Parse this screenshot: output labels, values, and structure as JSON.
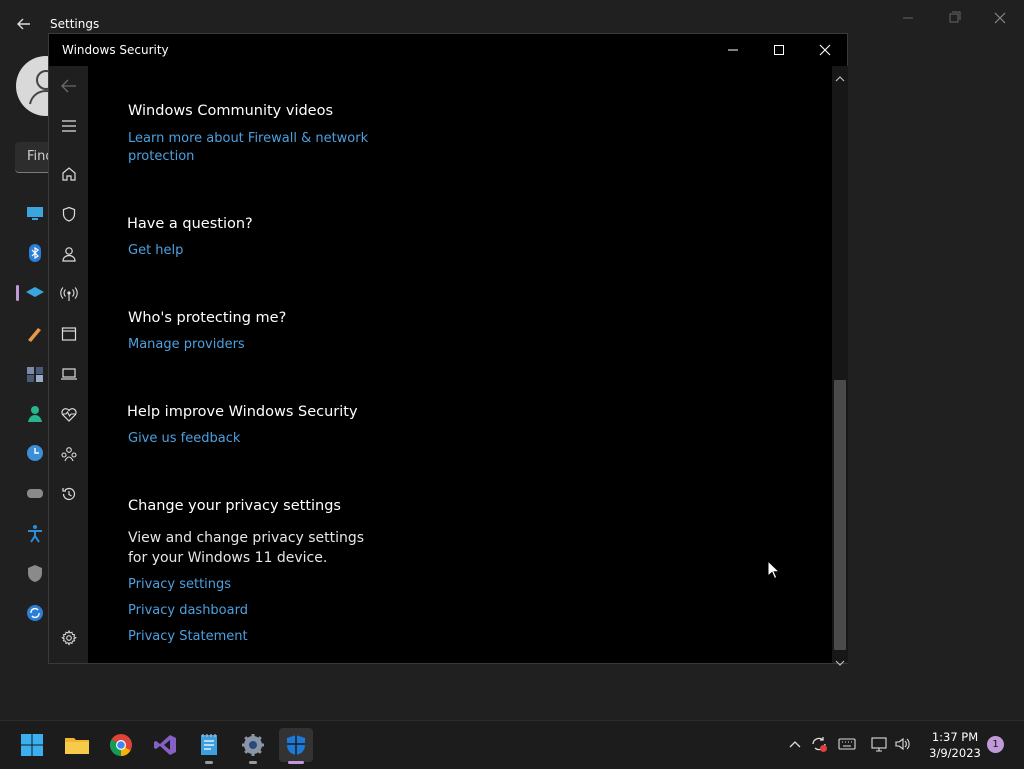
{
  "settings_window": {
    "title": "Settings",
    "search_placeholder": "Find"
  },
  "security_window": {
    "title": "Windows Security",
    "sections": {
      "videos": {
        "heading": "Windows Community videos",
        "link": "Learn more about Firewall & network",
        "link_line2": "protection"
      },
      "question": {
        "heading": "Have a question?",
        "link": "Get help"
      },
      "protecting": {
        "heading": "Who's protecting me?",
        "link": "Manage providers"
      },
      "improve": {
        "heading": "Help improve Windows Security",
        "link": "Give us feedback"
      },
      "privacy": {
        "heading": "Change your privacy settings",
        "body_line1": "View and change privacy settings",
        "body_line2": "for your Windows 11 device.",
        "links": [
          "Privacy settings",
          "Privacy dashboard",
          "Privacy Statement"
        ]
      }
    }
  },
  "taskbar": {
    "time": "1:37 PM",
    "date": "3/9/2023",
    "notification_count": "1"
  },
  "colors": {
    "link": "#4ca0e0",
    "accent": "#c09ad8",
    "content_bg": "#000000",
    "rail_bg": "#1f1f1f"
  }
}
